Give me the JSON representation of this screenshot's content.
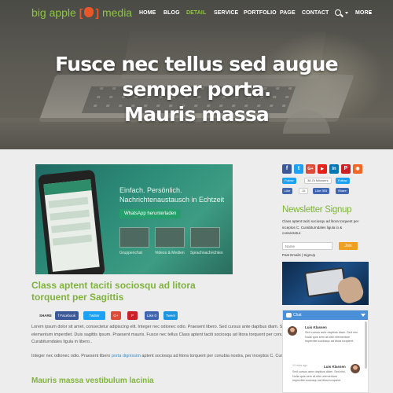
{
  "brand": {
    "name_part1": "big apple",
    "bracket_open": "[",
    "bracket_close": "]",
    "name_part2": "media",
    "accent": "#8dc63f",
    "logo_color": "#e8572a"
  },
  "nav": {
    "items": [
      "HOME",
      "BLOG",
      "DETAIL",
      "SERVICE",
      "PORTFOLIO",
      "PAGE",
      "CONTACT",
      "MORE"
    ],
    "active": "DETAIL"
  },
  "hero": {
    "title_line1": "Fusce nec tellus sed augue semper porta.",
    "title_line2": "Mauris massa"
  },
  "post": {
    "image": {
      "line1": "Einfach. Persönlich.",
      "line2": "Nachrichtenaustausch in Echtzeit",
      "button": "WhatsApp herunterladen",
      "captions": [
        "Gruppenchat",
        "Videos & Medien",
        "Sprachnachrichten"
      ]
    },
    "title": "Class aptent taciti sociosqu ad litora torquent per Sagittis",
    "share_label": "SHARE",
    "share_buttons": [
      "f Facebook",
      "Twitter",
      "G+",
      "P",
      "Like 0",
      "Tweet"
    ],
    "para1": "Lorem ipsum dolor sit amet, consectetur adipiscing elit. Integer nec odionec odio. Praesent libero. Sed cursus ante dapibus diam. Sed nisi. Nulla quis sem at nibh elementum imperdiet. Duis sagittis ipsum. Praesent mauris. Fusce nec tellus Class aptent taciti sociosqu ad litora torquent per conubia nostra, per inceptos C. Curabiturndales ligula in libero..",
    "para2_before": "Integer nec odionec odio. Praesent libero ",
    "para2_link": "porta dignissim",
    "para2_after": " aptent sociosqu ad litora torquent per conubia nostra, per inceptos C. Curabiturndales.",
    "subheading": "Mauris massa vestibulum lacinia"
  },
  "sidebar": {
    "social": [
      {
        "name": "facebook",
        "glyph": "f",
        "color": "#3b5998"
      },
      {
        "name": "twitter",
        "glyph": "t",
        "color": "#1da1f2"
      },
      {
        "name": "google-plus",
        "glyph": "G+",
        "color": "#dd4b39"
      },
      {
        "name": "youtube",
        "glyph": "▶",
        "color": "#e62117"
      },
      {
        "name": "linkedin",
        "glyph": "in",
        "color": "#0077b5"
      },
      {
        "name": "pinterest",
        "glyph": "P",
        "color": "#cb2027"
      },
      {
        "name": "rss",
        "glyph": "◉",
        "color": "#f26522"
      }
    ],
    "follow": {
      "label": "Follow",
      "count": "38.7k followers",
      "like": "Like",
      "like_count": "15",
      "like2": "Like 353",
      "share": "Share"
    },
    "newsletter": {
      "title": "Newsletter Signup",
      "desc": "Class aptent taciti sociosqu ad litora torquent per inceptos C. Curabiturndales ligula in & consectetur.",
      "input_placeholder": "Name",
      "button": "Join",
      "past": "Past Emails | SignUp"
    },
    "chat": {
      "label": "Chat",
      "messages": [
        {
          "name": "Luis Klassen",
          "text": "Sed cursus ante dapibus diam. Sed nisi. Nulla quis sem at nibh elementum imperdiet sociosqu ad litora torquent.",
          "time": ""
        },
        {
          "name": "Luis Klassen",
          "text": "Sed cursus ante dapibus diam. Sed nisi. Nulla quis sem at nibh elementum imperdiet sociosqu ad litora torquent.",
          "time": "13 mins ago"
        }
      ]
    }
  }
}
